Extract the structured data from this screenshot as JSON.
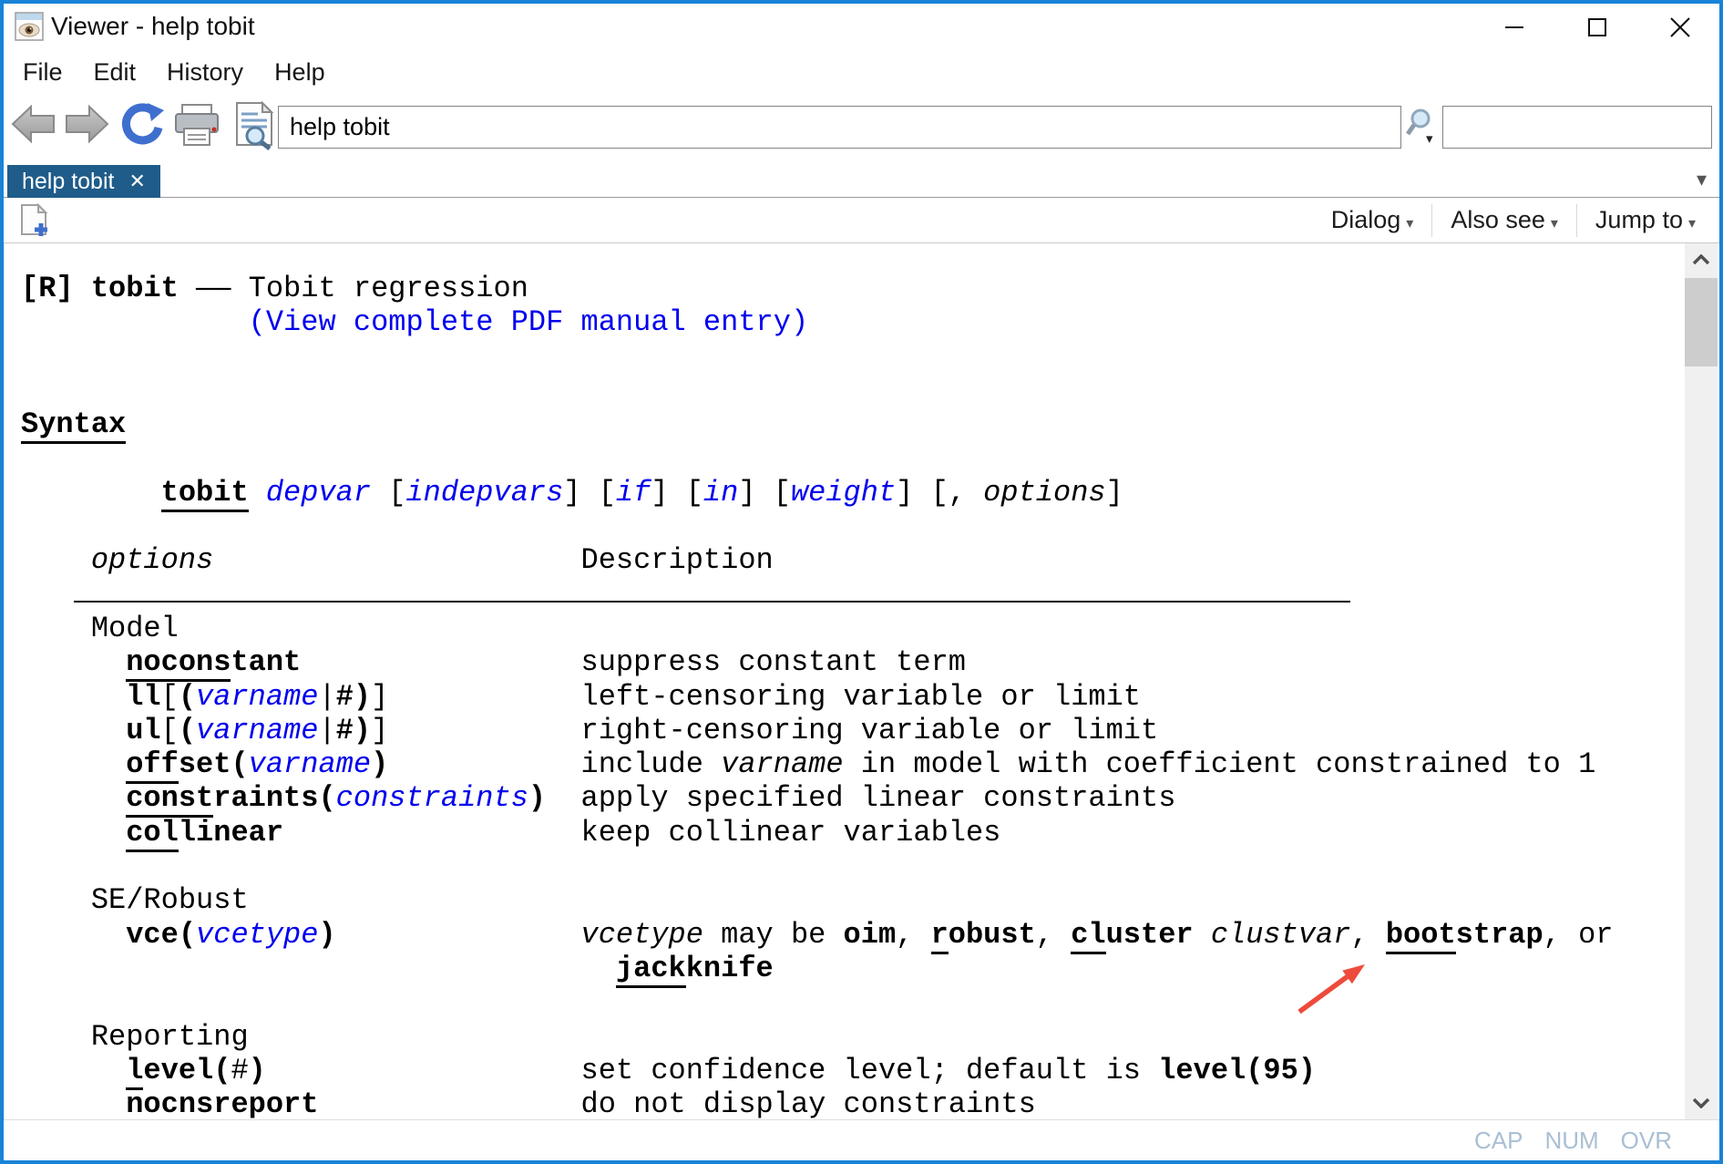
{
  "window": {
    "title": "Viewer - help tobit"
  },
  "menu": {
    "items": [
      "File",
      "Edit",
      "History",
      "Help"
    ]
  },
  "toolbar": {
    "address_value": "help tobit",
    "search_value": ""
  },
  "tabs": {
    "active_label": "help tobit"
  },
  "doc_toolbar": {
    "dialog_label": "Dialog",
    "also_see_label": "Also see",
    "jump_to_label": "Jump to"
  },
  "status": {
    "cap": "CAP",
    "num": "NUM",
    "ovr": "OVR"
  },
  "icons": {
    "close": "✕",
    "dropdown": "▾"
  },
  "colors": {
    "window_border": "#1883d7",
    "tab_blue": "#1f5c8a",
    "link_blue": "#0000ee",
    "annotation_red": "#ee4b3c",
    "status_gray": "#a9bfd3"
  },
  "annotation": {
    "type": "red-arrow",
    "points_at": "bootstrap"
  },
  "help_text": {
    "lines": [
      {
        "segments": [
          {
            "t": "[R]",
            "s": "b"
          },
          {
            "t": " ",
            "s": "p"
          },
          {
            "t": "tobit",
            "s": "b"
          },
          {
            "t": " —— ",
            "s": "p"
          },
          {
            "t": "Tobit regression",
            "s": "p"
          }
        ]
      },
      {
        "segments": [
          {
            "t": "             ",
            "s": "p"
          },
          {
            "t": "(View complete PDF manual entry)",
            "s": "l"
          }
        ]
      },
      {
        "segments": []
      },
      {
        "segments": []
      },
      {
        "segments": [
          {
            "t": "Syntax",
            "s": "bu"
          }
        ]
      },
      {
        "segments": []
      },
      {
        "segments": [
          {
            "t": "        ",
            "s": "p"
          },
          {
            "t": "tobit",
            "s": "bu"
          },
          {
            "t": " ",
            "s": "p"
          },
          {
            "t": "depvar",
            "s": "li"
          },
          {
            "t": " [",
            "s": "p"
          },
          {
            "t": "indepvars",
            "s": "li"
          },
          {
            "t": "] [",
            "s": "p"
          },
          {
            "t": "if",
            "s": "li"
          },
          {
            "t": "] [",
            "s": "p"
          },
          {
            "t": "in",
            "s": "li"
          },
          {
            "t": "] [",
            "s": "p"
          },
          {
            "t": "weight",
            "s": "li"
          },
          {
            "t": "] [, ",
            "s": "p"
          },
          {
            "t": "options",
            "s": "i"
          },
          {
            "t": "]",
            "s": "p"
          }
        ]
      },
      {
        "segments": []
      },
      {
        "segments": [
          {
            "t": "    ",
            "s": "p"
          },
          {
            "t": "options",
            "s": "i"
          },
          {
            "t": "                     ",
            "s": "p"
          },
          {
            "t": "Description",
            "s": "p"
          }
        ]
      },
      {
        "rule": true
      },
      {
        "segments": [
          {
            "t": "    Model",
            "s": "p"
          }
        ]
      },
      {
        "segments": [
          {
            "t": "      ",
            "s": "p"
          },
          {
            "t": "nocons",
            "s": "bu"
          },
          {
            "t": "tant",
            "s": "b"
          },
          {
            "t": "                ",
            "s": "p"
          },
          {
            "t": "suppress constant term",
            "s": "p"
          }
        ]
      },
      {
        "segments": [
          {
            "t": "      ",
            "s": "p"
          },
          {
            "t": "ll",
            "s": "b"
          },
          {
            "t": "[",
            "s": "p"
          },
          {
            "t": "(",
            "s": "b"
          },
          {
            "t": "varname",
            "s": "li"
          },
          {
            "t": "|",
            "s": "p"
          },
          {
            "t": "#",
            "s": "b"
          },
          {
            "t": ")",
            "s": "b"
          },
          {
            "t": "]",
            "s": "p"
          },
          {
            "t": "           ",
            "s": "p"
          },
          {
            "t": "left-censoring variable or limit",
            "s": "p"
          }
        ]
      },
      {
        "segments": [
          {
            "t": "      ",
            "s": "p"
          },
          {
            "t": "ul",
            "s": "b"
          },
          {
            "t": "[",
            "s": "p"
          },
          {
            "t": "(",
            "s": "b"
          },
          {
            "t": "varname",
            "s": "li"
          },
          {
            "t": "|",
            "s": "p"
          },
          {
            "t": "#",
            "s": "b"
          },
          {
            "t": ")",
            "s": "b"
          },
          {
            "t": "]",
            "s": "p"
          },
          {
            "t": "           ",
            "s": "p"
          },
          {
            "t": "right-censoring variable or limit",
            "s": "p"
          }
        ]
      },
      {
        "segments": [
          {
            "t": "      ",
            "s": "p"
          },
          {
            "t": "off",
            "s": "bu"
          },
          {
            "t": "set",
            "s": "b"
          },
          {
            "t": "(",
            "s": "b"
          },
          {
            "t": "varname",
            "s": "li"
          },
          {
            "t": ")",
            "s": "b"
          },
          {
            "t": "           ",
            "s": "p"
          },
          {
            "t": "include ",
            "s": "p"
          },
          {
            "t": "varname",
            "s": "i"
          },
          {
            "t": " in model with coefficient constrained to 1",
            "s": "p"
          }
        ]
      },
      {
        "segments": [
          {
            "t": "      ",
            "s": "p"
          },
          {
            "t": "const",
            "s": "bu"
          },
          {
            "t": "raints",
            "s": "b"
          },
          {
            "t": "(",
            "s": "b"
          },
          {
            "t": "constraints",
            "s": "li"
          },
          {
            "t": ")",
            "s": "b"
          },
          {
            "t": "  ",
            "s": "p"
          },
          {
            "t": "apply specified linear constraints",
            "s": "p"
          }
        ]
      },
      {
        "segments": [
          {
            "t": "      ",
            "s": "p"
          },
          {
            "t": "col",
            "s": "bu"
          },
          {
            "t": "linear",
            "s": "b"
          },
          {
            "t": "                 ",
            "s": "p"
          },
          {
            "t": "keep collinear variables",
            "s": "p"
          }
        ]
      },
      {
        "segments": []
      },
      {
        "segments": [
          {
            "t": "    SE/Robust",
            "s": "p"
          }
        ]
      },
      {
        "segments": [
          {
            "t": "      ",
            "s": "p"
          },
          {
            "t": "vce",
            "s": "b"
          },
          {
            "t": "(",
            "s": "b"
          },
          {
            "t": "vcetype",
            "s": "li"
          },
          {
            "t": ")",
            "s": "b"
          },
          {
            "t": "              ",
            "s": "p"
          },
          {
            "t": "vcetype",
            "s": "i"
          },
          {
            "t": " may be ",
            "s": "p"
          },
          {
            "t": "oim",
            "s": "b"
          },
          {
            "t": ", ",
            "s": "p"
          },
          {
            "t": "r",
            "s": "bu"
          },
          {
            "t": "obust",
            "s": "b"
          },
          {
            "t": ", ",
            "s": "p"
          },
          {
            "t": "cl",
            "s": "bu"
          },
          {
            "t": "uster",
            "s": "b"
          },
          {
            "t": " ",
            "s": "p"
          },
          {
            "t": "clustvar",
            "s": "i"
          },
          {
            "t": ", ",
            "s": "p"
          },
          {
            "t": "boot",
            "s": "bu"
          },
          {
            "t": "strap",
            "s": "b"
          },
          {
            "t": ", or",
            "s": "p"
          }
        ]
      },
      {
        "segments": [
          {
            "t": "                                  ",
            "s": "p"
          },
          {
            "t": "jack",
            "s": "bu"
          },
          {
            "t": "knife",
            "s": "b"
          }
        ]
      },
      {
        "segments": []
      },
      {
        "segments": [
          {
            "t": "    Reporting",
            "s": "p"
          }
        ]
      },
      {
        "segments": [
          {
            "t": "      ",
            "s": "p"
          },
          {
            "t": "l",
            "s": "bu"
          },
          {
            "t": "evel",
            "s": "b"
          },
          {
            "t": "(",
            "s": "b"
          },
          {
            "t": "#",
            "s": "p"
          },
          {
            "t": ")",
            "s": "b"
          },
          {
            "t": "                  ",
            "s": "p"
          },
          {
            "t": "set confidence level; default is ",
            "s": "p"
          },
          {
            "t": "level(95)",
            "s": "b"
          }
        ]
      },
      {
        "segments": [
          {
            "t": "      ",
            "s": "p"
          },
          {
            "t": "nocnsreport",
            "s": "b"
          },
          {
            "t": "               ",
            "s": "p"
          },
          {
            "t": "do not display constraints",
            "s": "p"
          }
        ]
      }
    ]
  }
}
